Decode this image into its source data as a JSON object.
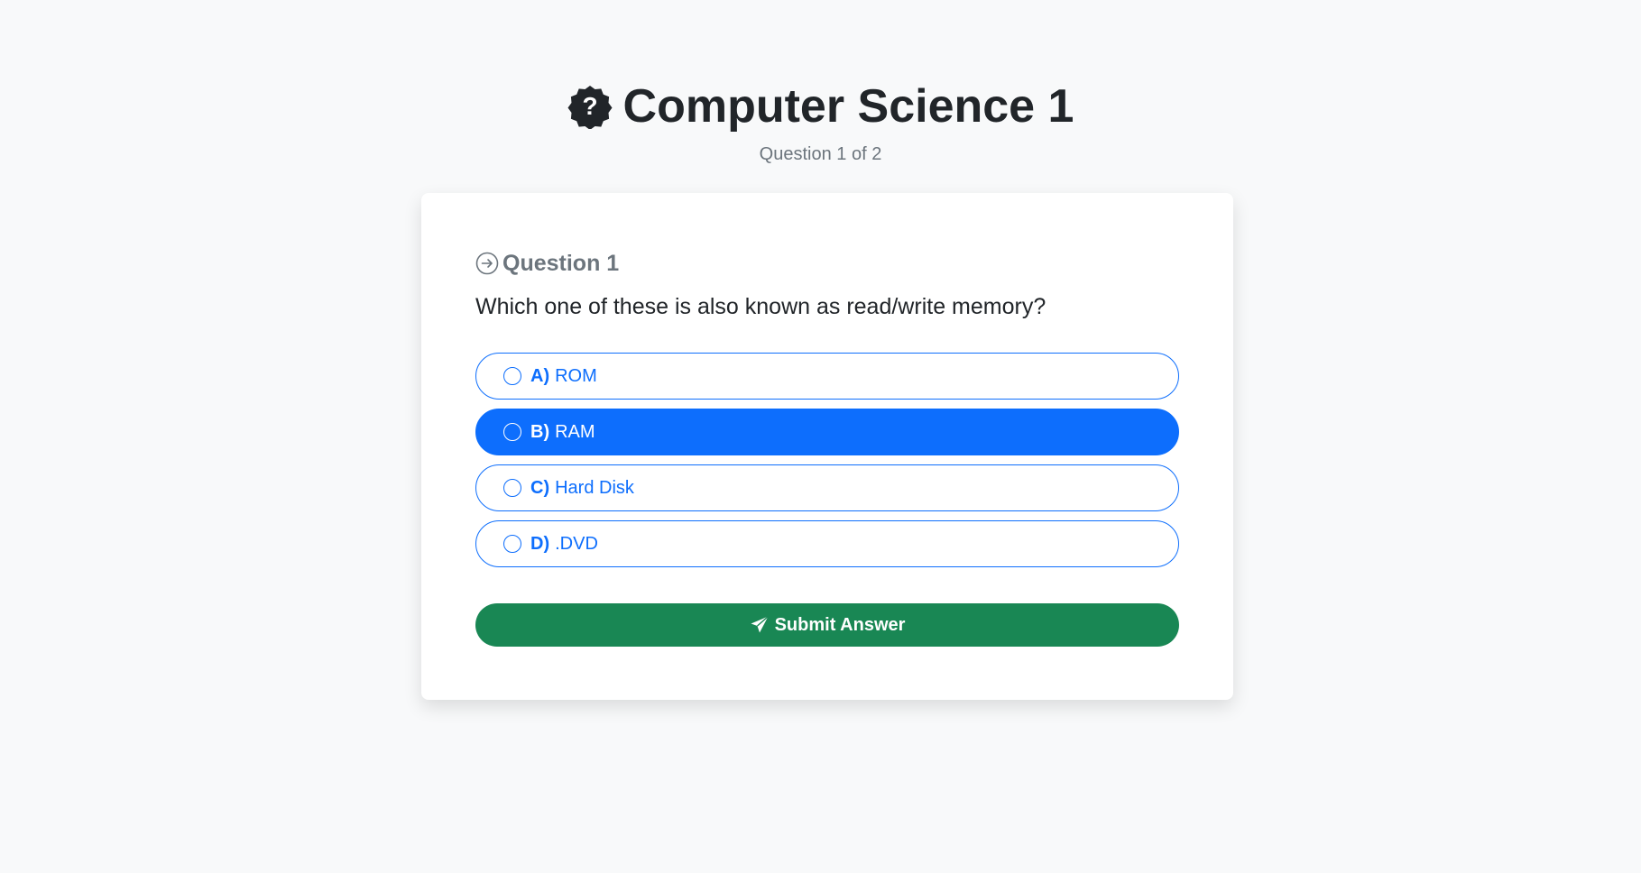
{
  "quiz": {
    "title": "Computer Science 1",
    "title_icon": "question-badge-icon",
    "progress_text": "Question 1 of 2"
  },
  "question": {
    "heading": "Question 1",
    "heading_icon": "arrow-right-circle-icon",
    "text": "Which one of these is also known as read/write memory?",
    "options": [
      {
        "letter": "A)",
        "label": "ROM",
        "selected": false
      },
      {
        "letter": "B)",
        "label": "RAM",
        "selected": true
      },
      {
        "letter": "C)",
        "label": "Hard Disk",
        "selected": false
      },
      {
        "letter": "D)",
        "label": ".DVD",
        "selected": false
      }
    ]
  },
  "submit": {
    "label": "Submit Answer",
    "icon": "send-icon"
  },
  "colors": {
    "primary": "#0d6efd",
    "success": "#198754",
    "background": "#f8f9fa",
    "muted": "#6c757d"
  }
}
